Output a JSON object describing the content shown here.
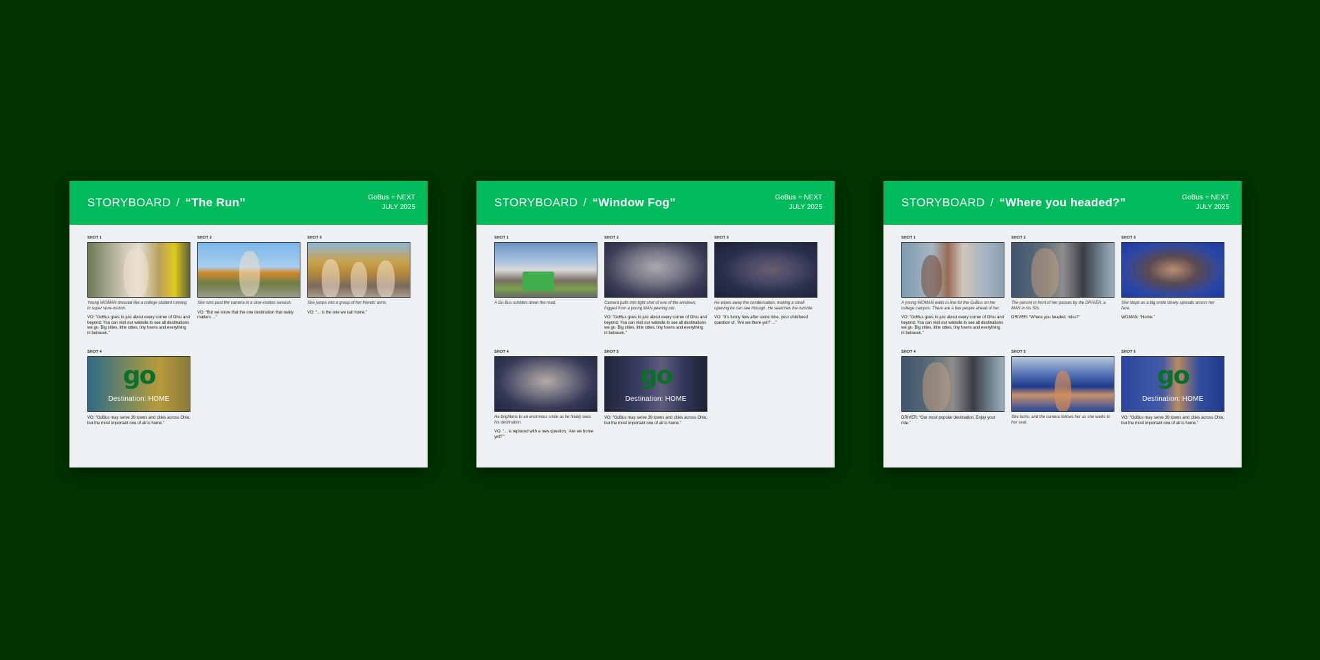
{
  "boards": [
    {
      "label": "STORYBOARD",
      "separator": "/",
      "name": "“The Run”",
      "meta_line1": "GoBus + NEXT",
      "meta_line2": "JULY 2025",
      "shots": [
        {
          "label": "SHOT 1",
          "desc": "Young WOMAN dressed like a college student running in super slow-motion.",
          "vo": "VO: “GoBus goes to just about every corner of Ohio and beyond. You can visit our website to see all destinations we go. Big cities, little cities, tiny towns and everything in between.”"
        },
        {
          "label": "SHOT 2",
          "desc": "She runs past the camera in a slow-motion swoosh.",
          "vo": "VO: “But we know that the one destination that really matters ...”"
        },
        {
          "label": "SHOT 3",
          "desc": "She jumps into a group of her friends’ arms.",
          "vo": "VO: “... is the one we call home.”"
        },
        {
          "label": "SHOT 4",
          "desc": "",
          "vo": "VO: “GoBus may serve 39 towns and cities across Ohio, but the most important one of all is home.”",
          "logo": "go",
          "caption": "Destination: HOME"
        }
      ]
    },
    {
      "label": "STORYBOARD",
      "separator": "/",
      "name": "“Window Fog”",
      "meta_line1": "GoBus + NEXT",
      "meta_line2": "JULY 2025",
      "shots": [
        {
          "label": "SHOT 1",
          "desc": "A Go Bus rumbles down the road.",
          "vo": ""
        },
        {
          "label": "SHOT 2",
          "desc": "Camera pulls into tight shot of one of the windows, fogged from a young MAN peering out.",
          "vo": "VO: “GoBus goes to just about every corner of Ohio and beyond. You can visit our website to see all destinations we go. Big cities, little cities, tiny towns and everything in between.”"
        },
        {
          "label": "SHOT 3",
          "desc": "He wipes away the condensation, making a small opening he can see through. He searches the outside.",
          "vo": "VO: “It’s funny how after some time, your childhood question of, ‘Are we there yet?’ ...”"
        },
        {
          "label": "SHOT 4",
          "desc": "He brightens to an enormous smile as he finally sees his destination.",
          "vo": "VO: “... is replaced with a new question, ‘Are we home yet?’”"
        },
        {
          "label": "SHOT 5",
          "desc": "",
          "vo": "VO: “GoBus may serve 39 towns and cities across Ohio, but the most important one of all is home.”",
          "logo": "go",
          "caption": "Destination: HOME"
        }
      ]
    },
    {
      "label": "STORYBOARD",
      "separator": "/",
      "name": "“Where you headed?”",
      "meta_line1": "GoBus + NEXT",
      "meta_line2": "JULY 2025",
      "shots": [
        {
          "label": "SHOT 1",
          "desc": "A young WOMAN waits in line for the GoBus on her college campus. There are a few people ahead of her.",
          "vo": "VO: “GoBus goes to just about every corner of Ohio and beyond. You can visit our website to see all destinations we go. Big cities, little cities, tiny towns and everything in between.”"
        },
        {
          "label": "SHOT 2",
          "desc": "The person in front of her passes by the DRIVER, a MAN in his 50s.",
          "vo": "DRIVER: “Where you headed, miss?”"
        },
        {
          "label": "SHOT 3",
          "desc": "She stops as a big smile slowly spreads across her face.",
          "vo": "WOMAN: “Home.”"
        },
        {
          "label": "SHOT 4",
          "desc": "",
          "vo": "DRIVER: “Our most popular destination. Enjoy your ride.”"
        },
        {
          "label": "SHOT 5",
          "desc": "She turns, and the camera follows her as she walks to her seat.",
          "vo": ""
        },
        {
          "label": "SHOT 6",
          "desc": "",
          "vo": "VO: “GoBus may serve 39 towns and cities across Ohio, but the most important one of all is home.”",
          "logo": "go",
          "caption": "Destination: HOME"
        }
      ]
    }
  ],
  "colors": {
    "background": "#003300",
    "header": "#00bb5c",
    "board": "#eef1f3",
    "logo": "#0b6e2a"
  }
}
